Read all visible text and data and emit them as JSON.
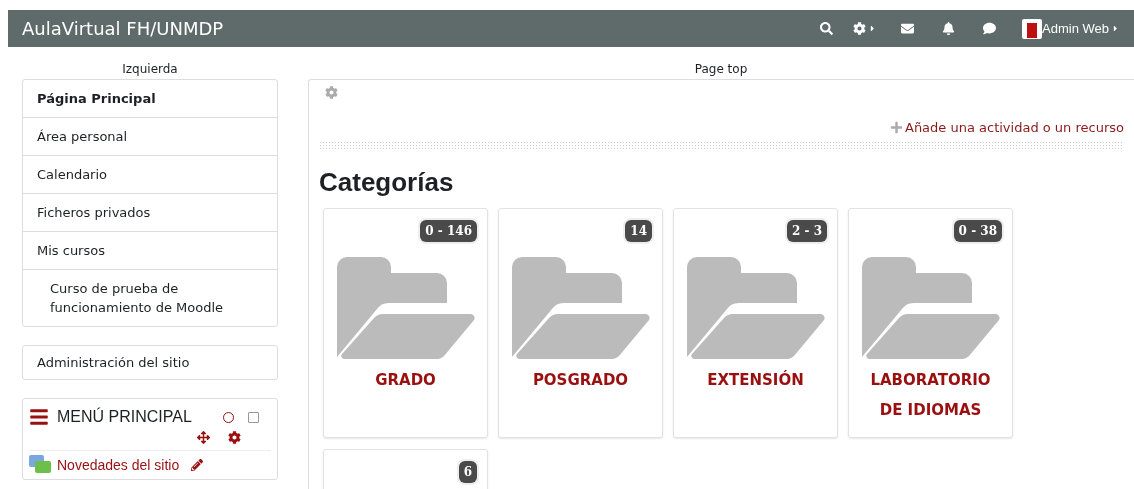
{
  "navbar": {
    "site_name": "AulaVirtual FH/UNMDP",
    "user_name": "Admin Web"
  },
  "left_region": {
    "label": "Izquierda"
  },
  "navigation": {
    "items": [
      {
        "label": "Página Principal",
        "selected": true
      },
      {
        "label": "Área personal",
        "selected": false
      },
      {
        "label": "Calendario",
        "selected": false
      },
      {
        "label": "Ficheros privados",
        "selected": false
      },
      {
        "label": "Mis cursos",
        "selected": false,
        "children": [
          {
            "label": "Curso de prueba de funcionamiento de Moodle",
            "selected": false
          }
        ]
      }
    ]
  },
  "admin_block": {
    "label": "Administración del sitio"
  },
  "main_menu_block": {
    "title": "MENÚ PRINCIPAL",
    "items": [
      {
        "label": "Novedades del sitio"
      }
    ]
  },
  "top_region": {
    "label": "Page top"
  },
  "main": {
    "add_link": "Añade una actividad o un recurso",
    "heading": "Categorías",
    "categories": [
      {
        "name": "GRADO",
        "count": "0 - 146"
      },
      {
        "name": "POSGRADO",
        "count": "14"
      },
      {
        "name": "EXTENSIÓN",
        "count": "2 - 3"
      },
      {
        "name": "LABORATORIO DE IDIOMAS",
        "count": "0 - 38"
      },
      {
        "count": "6"
      }
    ]
  }
}
